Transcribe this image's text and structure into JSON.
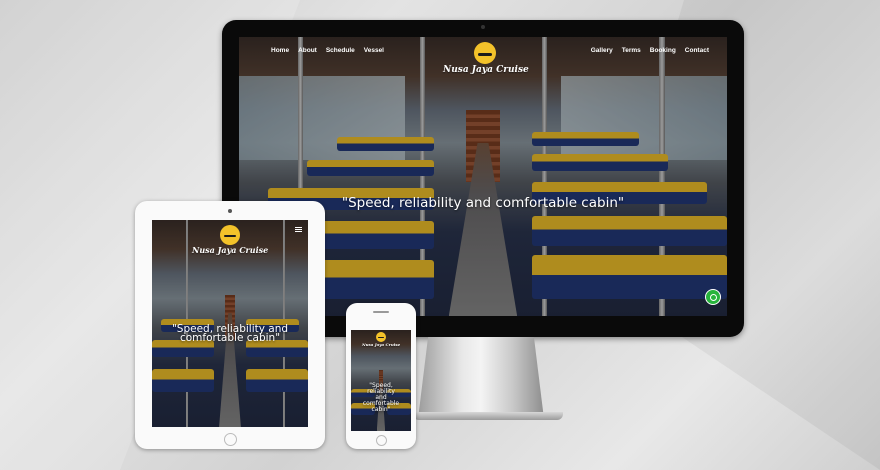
{
  "site": {
    "brand": "Nusa Jaya Cruise",
    "tagline": "\"Speed, reliability and comfortable cabin\"",
    "nav_left": [
      "Home",
      "About",
      "Schedule",
      "Vessel"
    ],
    "nav_right": [
      "Gallery",
      "Terms",
      "Booking",
      "Contact"
    ]
  },
  "tablet": {
    "tagline_line1": "\"Speed, reliability and",
    "tagline_line2": "comfortable cabin\""
  },
  "phone": {
    "tagline_lines": [
      "\"Speed,",
      "reliability",
      "and",
      "comfortable",
      "cabin\""
    ]
  },
  "colors": {
    "accent_yellow": "#f3c22a",
    "seat_blue": "#233a7a",
    "whatsapp_green": "#27b43c"
  },
  "icons": {
    "whatsapp": "whatsapp-icon",
    "menu": "hamburger-menu-icon",
    "logo": "boat-logo-icon"
  }
}
